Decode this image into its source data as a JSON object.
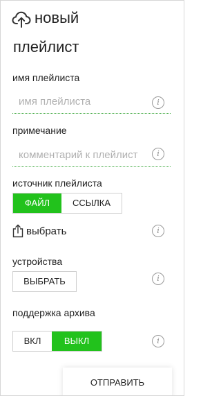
{
  "header": {
    "title_line1": "новый",
    "title_line2": "плейлист",
    "upload_icon": "cloud-upload-icon"
  },
  "fields": {
    "name_label": "имя плейлиста",
    "name_placeholder": "имя плейлиста",
    "name_value": "",
    "note_label": "примечание",
    "note_placeholder": "комментарий к плейлист",
    "note_value": ""
  },
  "source": {
    "label": "источник плейлиста",
    "options": [
      "ФАЙЛ",
      "ССЫЛКА"
    ],
    "selected": "ФАЙЛ",
    "choose_label": "выбрать",
    "choose_icon": "share-upload-icon"
  },
  "devices": {
    "label": "устройства",
    "button_label": "ВЫБРАТЬ"
  },
  "archive": {
    "label": "поддержка архива",
    "options": [
      "ВКЛ",
      "ВЫКЛ"
    ],
    "selected": "ВЫКЛ"
  },
  "submit_label": "ОТПРАВИТЬ",
  "info_icon_glyph": "i",
  "colors": {
    "accent": "#22c21c",
    "field_underline": "#37a537",
    "placeholder": "#b0b0b0"
  }
}
